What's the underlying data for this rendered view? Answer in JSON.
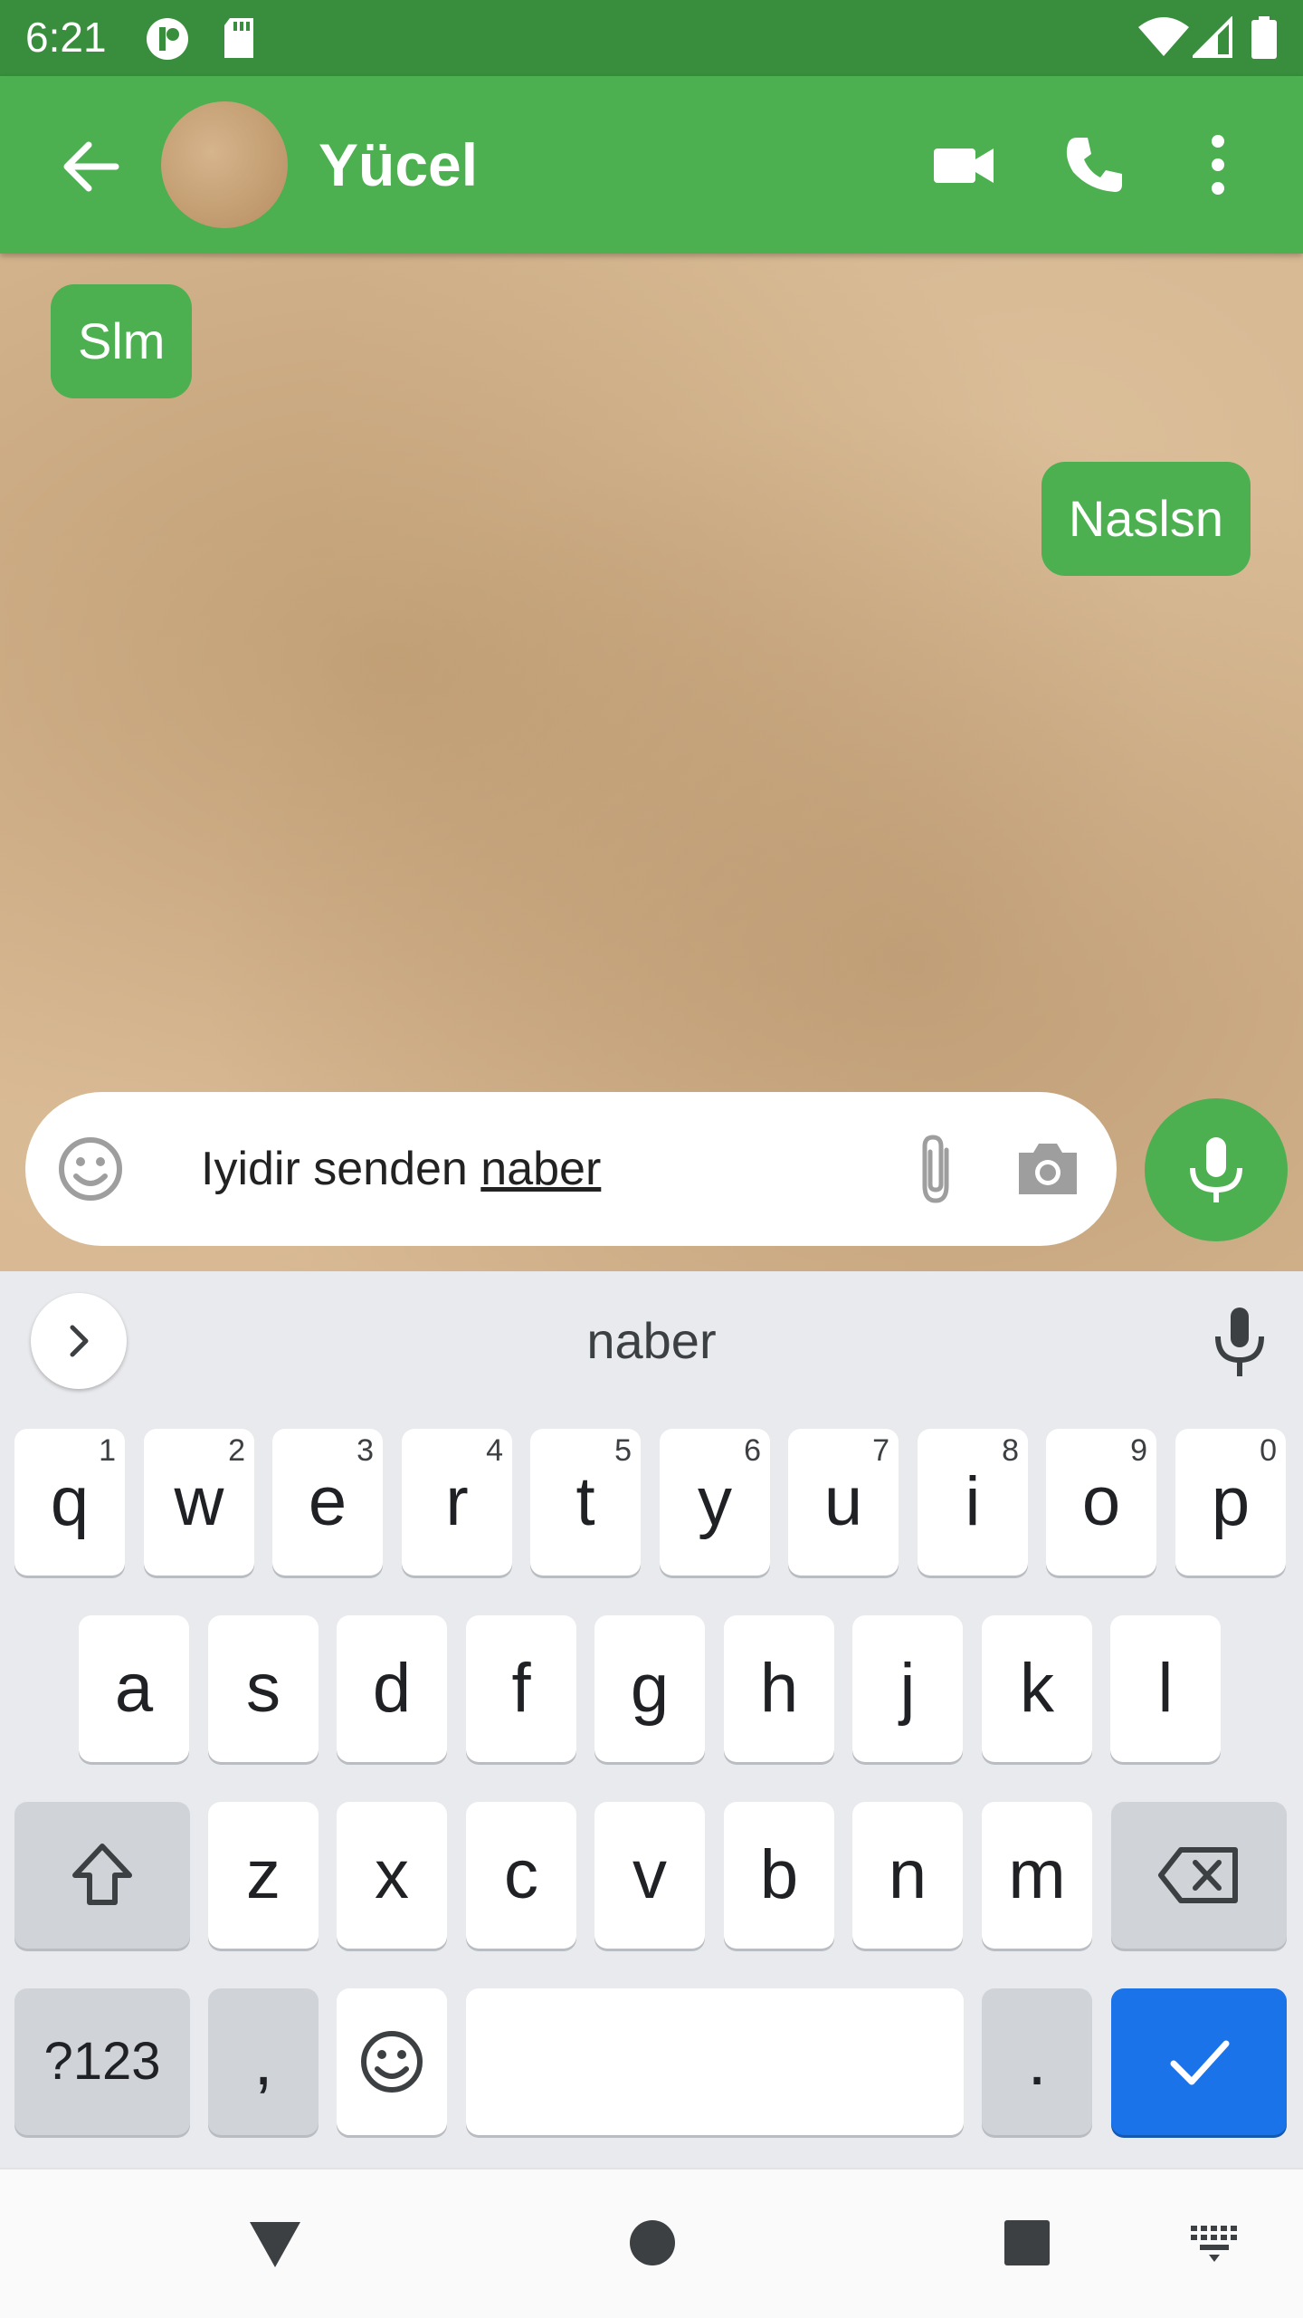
{
  "status_bar": {
    "time": "6:21"
  },
  "app_bar": {
    "contact_name": "Yücel",
    "colors": {
      "primary": "#4caf50",
      "status": "#388e3c"
    }
  },
  "messages": [
    {
      "direction": "incoming",
      "text": "Slm"
    },
    {
      "direction": "outgoing",
      "text": "Naslsn"
    }
  ],
  "composer": {
    "text_prefix": "Iyidir senden ",
    "text_composing": "naber"
  },
  "keyboard": {
    "suggestion": "naber",
    "row1": [
      {
        "label": "q",
        "hint": "1"
      },
      {
        "label": "w",
        "hint": "2"
      },
      {
        "label": "e",
        "hint": "3"
      },
      {
        "label": "r",
        "hint": "4"
      },
      {
        "label": "t",
        "hint": "5"
      },
      {
        "label": "y",
        "hint": "6"
      },
      {
        "label": "u",
        "hint": "7"
      },
      {
        "label": "i",
        "hint": "8"
      },
      {
        "label": "o",
        "hint": "9"
      },
      {
        "label": "p",
        "hint": "0"
      }
    ],
    "row2": [
      "a",
      "s",
      "d",
      "f",
      "g",
      "h",
      "j",
      "k",
      "l"
    ],
    "row3": [
      "z",
      "x",
      "c",
      "v",
      "b",
      "n",
      "m"
    ],
    "symbols_label": "?123",
    "comma_label": ",",
    "period_label": ".",
    "accent_color": "#1a73e8"
  }
}
